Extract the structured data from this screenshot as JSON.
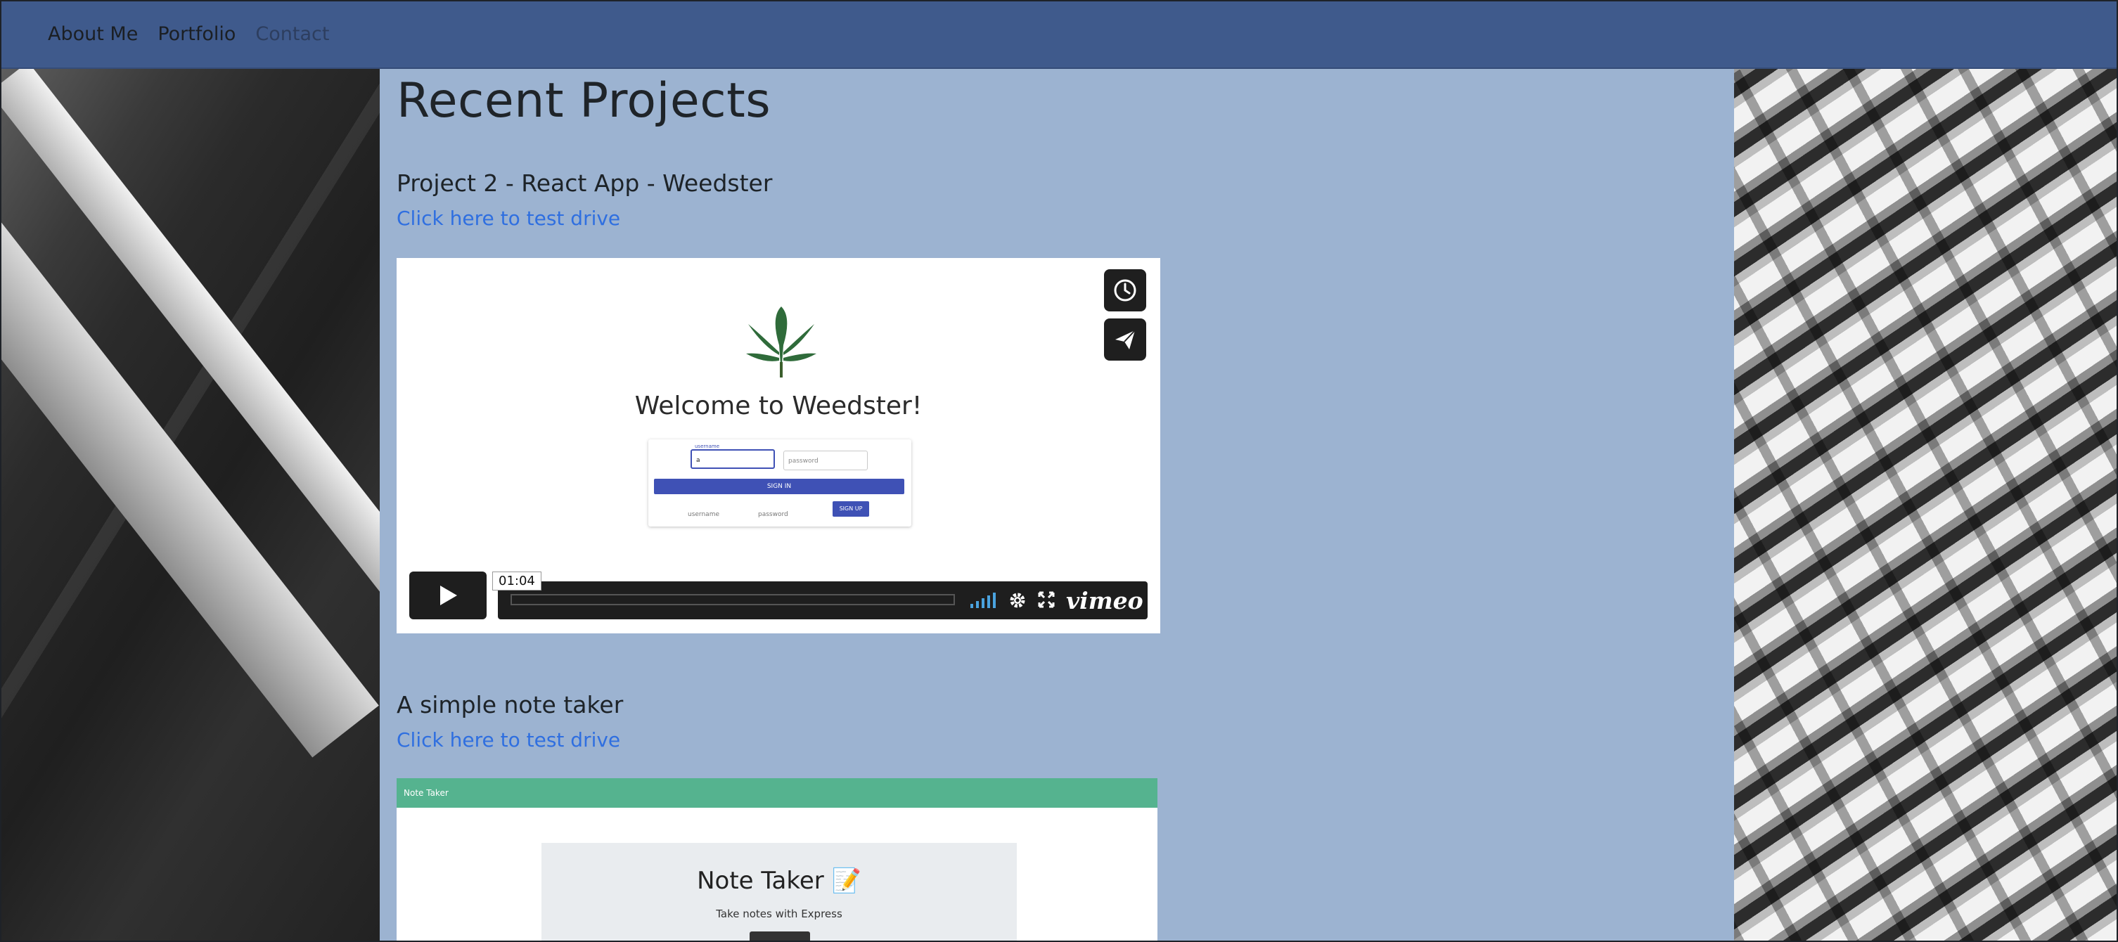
{
  "nav": {
    "items": [
      {
        "label": "About Me"
      },
      {
        "label": "Portfolio"
      },
      {
        "label": "Contact"
      }
    ]
  },
  "main": {
    "title": "Recent Projects",
    "projects": [
      {
        "title": "Project 2 - React App - Weedster",
        "link": "Click here to test drive",
        "preview": {
          "welcome": "Welcome to Weedster!",
          "username_label": "username",
          "username_value": "a",
          "password_placeholder": "password",
          "sign_in": "SIGN IN",
          "sign_up": "SIGN UP",
          "footer_username": "username",
          "footer_password": "password",
          "timecode": "01:04",
          "brand": "vimeo"
        }
      },
      {
        "title": "A simple note taker",
        "link": "Click here to test drive",
        "preview": {
          "bar_title": "Note Taker",
          "card_title": "Note Taker 📝",
          "card_sub": "Take notes with Express"
        }
      }
    ]
  },
  "colors": {
    "navbar": "#3f5a8c",
    "content_bg": "#9cb3d1",
    "link": "#2f6fe0",
    "note_bar": "#55b38f"
  }
}
